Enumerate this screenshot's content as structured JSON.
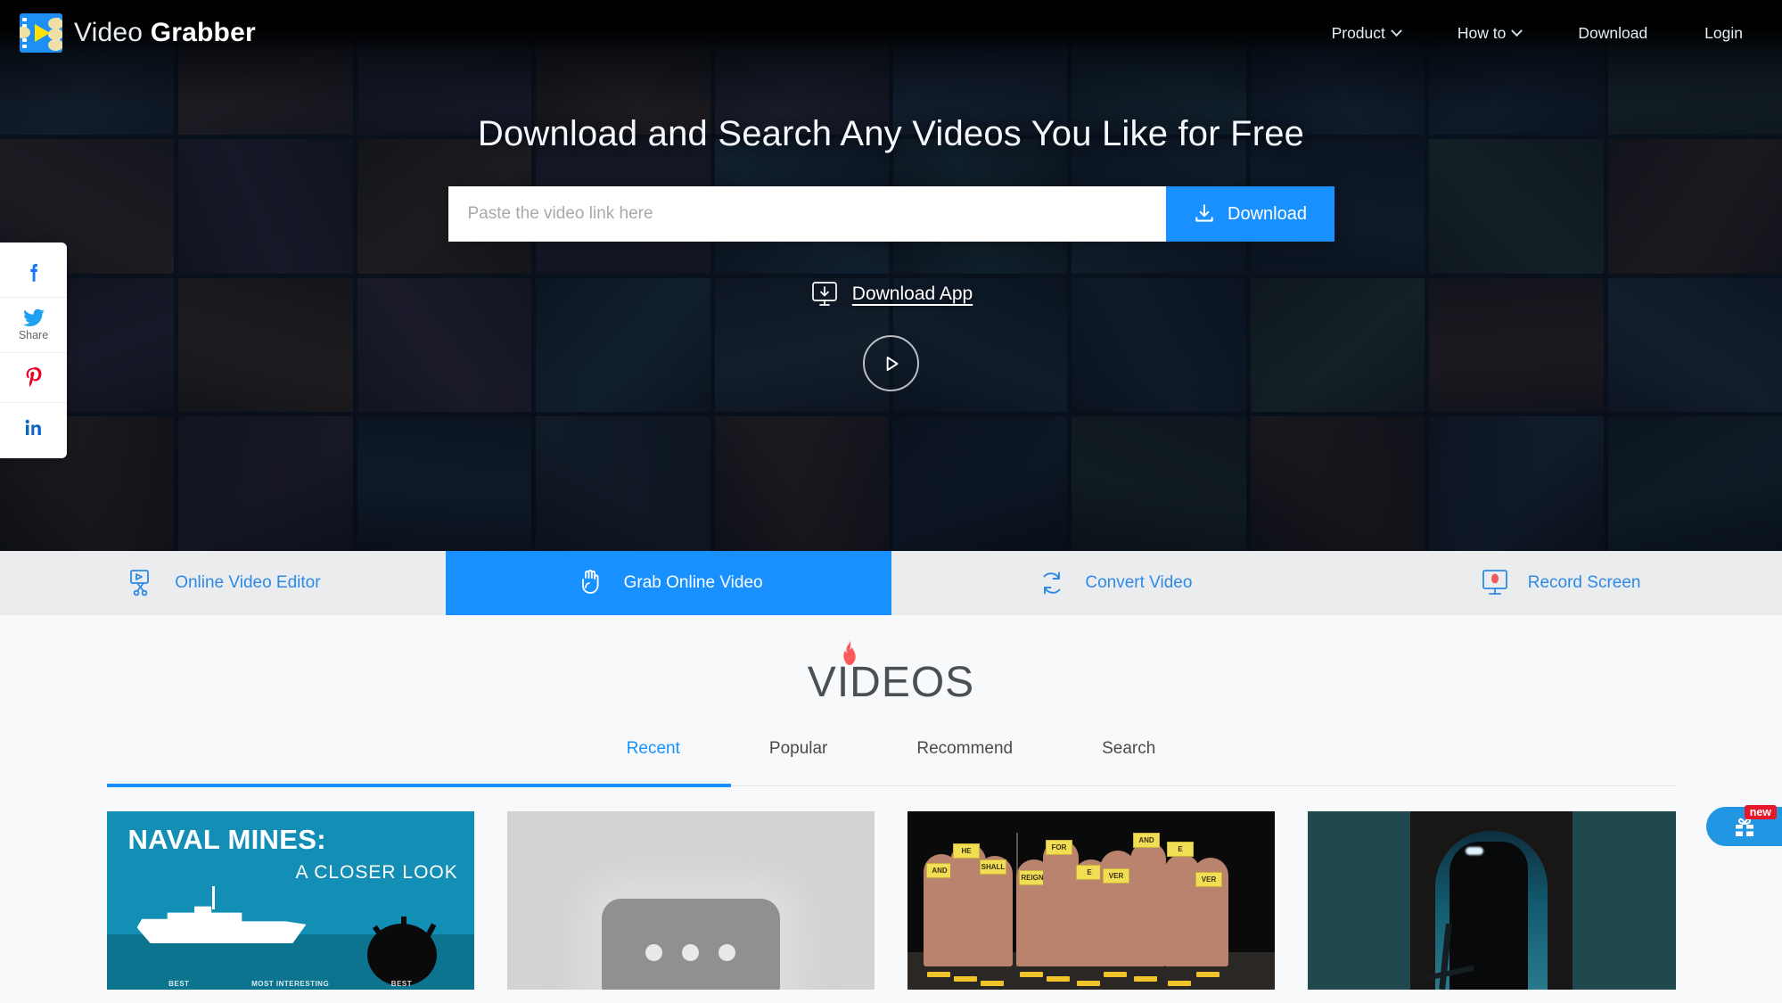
{
  "header": {
    "brand_prefix": "Video",
    "brand_suffix": "Grabber",
    "logo_icon": "film-strip-play-icon",
    "nav": [
      {
        "label": "Product",
        "caret": true,
        "name": "nav-product"
      },
      {
        "label": "How to",
        "caret": true,
        "name": "nav-how-to"
      },
      {
        "label": "Download",
        "caret": false,
        "name": "nav-download"
      },
      {
        "label": "Login",
        "caret": false,
        "name": "nav-login"
      }
    ]
  },
  "hero": {
    "title": "Download and Search Any Videos You Like for Free",
    "search": {
      "placeholder": "Paste the video link here",
      "value": "",
      "button_label": "Download",
      "button_icon": "download-icon",
      "accent": "#1890ff"
    },
    "download_app": {
      "label": "Download App",
      "icon": "monitor-download-icon"
    },
    "play_button_icon": "play-circle-icon"
  },
  "social": {
    "items": [
      {
        "name": "facebook",
        "icon": "facebook-icon",
        "label": "",
        "color": "#1877f2"
      },
      {
        "name": "twitter",
        "icon": "twitter-icon",
        "label": "Share",
        "color": "#1da1f2"
      },
      {
        "name": "pinterest",
        "icon": "pinterest-icon",
        "label": "",
        "color": "#e60023"
      },
      {
        "name": "linkedin",
        "icon": "linkedin-icon",
        "label": "",
        "color": "#0a66c2"
      }
    ]
  },
  "feature_tabs": {
    "active_index": 1,
    "active_color": "#1890ff",
    "items": [
      {
        "label": "Online Video Editor",
        "icon": "video-editor-scissors-icon"
      },
      {
        "label": "Grab Online Video",
        "icon": "grabbing-hand-icon"
      },
      {
        "label": "Convert Video",
        "icon": "convert-refresh-icon"
      },
      {
        "label": "Record Screen",
        "icon": "record-screen-icon"
      }
    ]
  },
  "videos_section": {
    "logo_text": "VIDEOS",
    "logo_icon": "flame-icon",
    "tabs": [
      {
        "label": "Recent",
        "active": true
      },
      {
        "label": "Popular",
        "active": false
      },
      {
        "label": "Recommend",
        "active": false
      },
      {
        "label": "Search",
        "active": false
      }
    ],
    "cards": [
      {
        "name": "video-card-naval-mines",
        "title": "NAVAL MINES:",
        "subtitle": "A CLOSER LOOK",
        "badges": [
          "BEST",
          "MOST INTERESTING",
          "BEST"
        ]
      },
      {
        "name": "video-card-placeholder",
        "title": "",
        "subtitle": "",
        "badges": []
      },
      {
        "name": "video-card-choir",
        "title": "",
        "subtitle": "",
        "signs": [
          "AND",
          "HE",
          "SHALL",
          "REIGN",
          "FOR",
          "E",
          "VER",
          "AND",
          "E",
          "VER"
        ]
      },
      {
        "name": "video-card-tunnel",
        "title": "",
        "subtitle": ""
      }
    ]
  },
  "promo": {
    "icon": "gift-icon",
    "badge": "new"
  }
}
